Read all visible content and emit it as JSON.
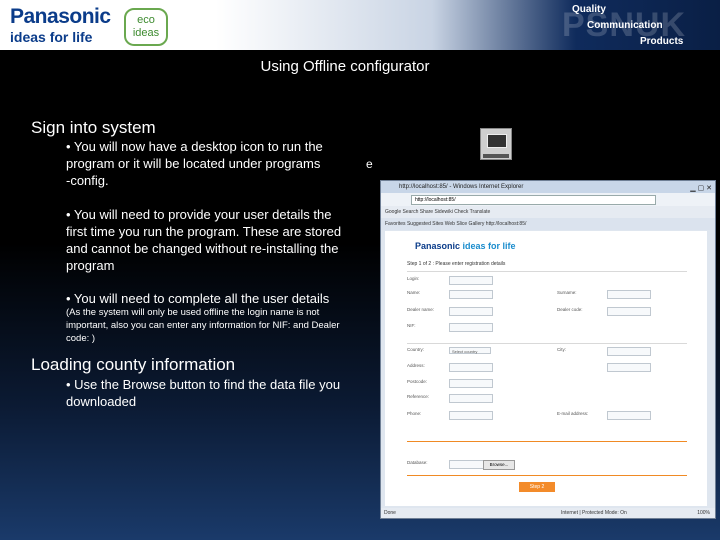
{
  "header": {
    "logo_main": "Panasonic",
    "logo_sub": "ideas for life",
    "eco_line1": "eco",
    "eco_line2": "ideas",
    "psn_ghost": "PSNUK",
    "psn_quality": "Quality",
    "psn_communication": "Communication",
    "psn_products": "Products"
  },
  "slide": {
    "title": "Using Offline configurator",
    "section1": "Sign into system",
    "bullet1_line1": "• You will now have a desktop icon to run the",
    "bullet1_line2": "program or it will be located under programs",
    "bullet1_line3": "-config.",
    "stray_char": "e",
    "bullet2_line1": "• You will need to provide your user details the",
    "bullet2_line2": "first time you run the program. These are stored",
    "bullet2_line3": "and cannot be changed without re-installing the",
    "bullet2_line4": "program",
    "bullet3": "• You will need to complete all the user details",
    "note_line1": "(As the system will only be used offline the login name is not",
    "note_line2": "important, also you can enter any information for NIF: and Dealer",
    "note_line3": "code: )",
    "section2": "Loading county information",
    "bullet4_line1": "• Use the Browse button to find the data file you",
    "bullet4_line2": "downloaded"
  },
  "browser": {
    "title": "http://localhost:85/ - Windows Internet Explorer",
    "address": "http://localhost:85/",
    "toolbar": "Google          Search   Share   Sidewiki   Check   Translate",
    "tabs": "Favorites   Suggested Sites   Web Slice Gallery        http://localhost:85/",
    "page_logo_a": "Panasonic ",
    "page_logo_b": "ideas for life",
    "page_heading": "Step 1 of 2 : Please enter registration details",
    "login_label": "Login:",
    "name_label": "Name:",
    "surname_label": "Surname:",
    "dealer_name_label": "Dealer name:",
    "dealer_code_label": "Dealer code:",
    "nif_label": "NIF:",
    "country_label": "Country:",
    "country_value": "Select country",
    "city_label": "City:",
    "address_label": "Address:",
    "postcode_label": "Postcode:",
    "reference_label": "Reference:",
    "phone_label": "Phone:",
    "email_label": "E-mail address:",
    "database_label": "Database:",
    "browse_label": "Browse...",
    "step_button": "Step 2",
    "status_left": "Done",
    "status_mid": "Internet | Protected Mode: On",
    "status_zoom": "100%"
  }
}
